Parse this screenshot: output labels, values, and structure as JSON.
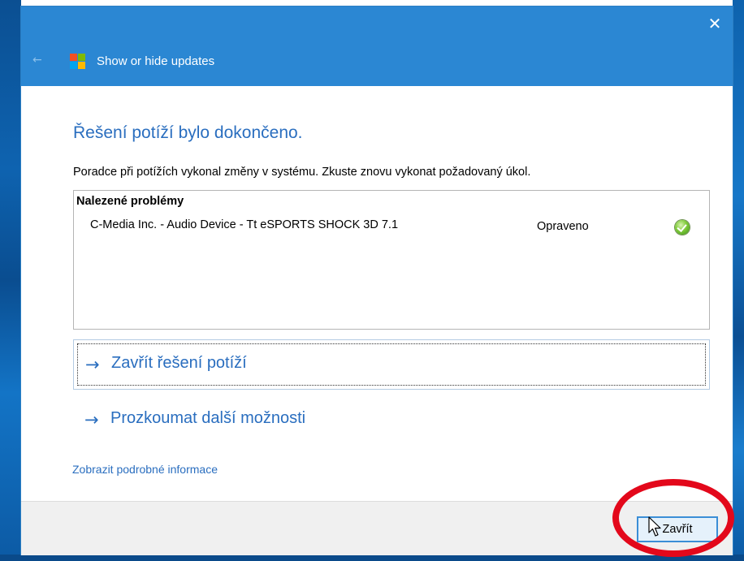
{
  "window": {
    "app_title": "Show or hide updates",
    "close_glyph": "✕",
    "back_glyph": "←"
  },
  "content": {
    "heading": "Řešení potíží bylo dokončeno.",
    "description": "Poradce při potížích vykonal změny v systému. Zkuste znovu vykonat požadovaný úkol.",
    "problems": {
      "header": "Nalezené problémy",
      "items": [
        {
          "name": "C-Media Inc. - Audio Device - Tt eSPORTS SHOCK 3D 7.1",
          "status": "Opraveno",
          "status_icon": "green-check-icon"
        }
      ]
    },
    "links": {
      "close_troubleshooter": "Zavřít řešení potíží",
      "explore_options": "Prozkoumat další možnosti",
      "arrow_glyph": "→",
      "details": "Zobrazit podrobné informace"
    }
  },
  "footer": {
    "close_button": "Zavřít"
  },
  "colors": {
    "title_bar": "#2b87d3",
    "link_blue": "#2a6ebf",
    "highlight_red": "#e3081b",
    "status_green": "#7fcb3a"
  }
}
